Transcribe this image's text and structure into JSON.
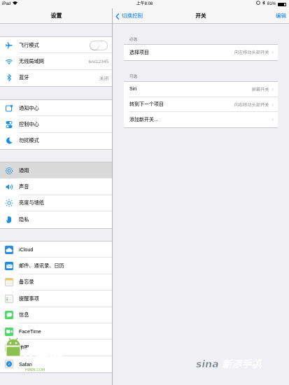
{
  "status_bar": {
    "device": "iPad",
    "time": "上午8:08",
    "battery": "81%",
    "battery_level": 0.81
  },
  "sidebar": {
    "title": "设置",
    "groups": [
      [
        {
          "label": "飞行模式",
          "icon": "airplane-icon",
          "toggle": "off"
        },
        {
          "label": "无线局域网",
          "icon": "wifi-icon",
          "value": "test12345"
        },
        {
          "label": "蓝牙",
          "icon": "bluetooth-icon",
          "value": "关闭"
        }
      ],
      [
        {
          "label": "通知中心",
          "icon": "notification-center-icon"
        },
        {
          "label": "控制中心",
          "icon": "control-center-icon"
        },
        {
          "label": "勿扰模式",
          "icon": "moon-icon"
        }
      ],
      [
        {
          "label": "通用",
          "icon": "gear-icon",
          "selected": true
        },
        {
          "label": "声音",
          "icon": "speaker-icon"
        },
        {
          "label": "亮度与墙纸",
          "icon": "brightness-icon"
        },
        {
          "label": "隐私",
          "icon": "hand-icon"
        }
      ],
      [
        {
          "label": "iCloud",
          "icon": "cloud-icon"
        },
        {
          "label": "邮件、通讯录、日历",
          "icon": "mail-icon"
        },
        {
          "label": "备忘录",
          "icon": "notes-icon"
        },
        {
          "label": "提醒事项",
          "icon": "reminders-icon"
        },
        {
          "label": "信息",
          "icon": "messages-icon"
        },
        {
          "label": "FaceTime",
          "icon": "facetime-icon"
        },
        {
          "label": "地图",
          "icon": "maps-icon"
        },
        {
          "label": "Safari",
          "icon": "safari-icon"
        }
      ]
    ]
  },
  "navbar": {
    "back_label": "切换控制",
    "title": "开关",
    "edit_label": "编辑"
  },
  "main": {
    "sections": [
      {
        "header": "必选",
        "rows": [
          {
            "label": "选择项目",
            "value": "向左移动头部开关"
          }
        ]
      },
      {
        "header": "可选",
        "rows": [
          {
            "label": "Siri",
            "value": "屏幕开关"
          },
          {
            "label": "转到下一个项目",
            "value": "向右移动头部开关"
          },
          {
            "label": "添加新开关...",
            "value": ""
          }
        ]
      }
    ],
    "chevron": "›"
  },
  "watermarks": {
    "left_text": "安卓网",
    "left_sub": "HIAPK.COM",
    "right_text": "sina 新浪手机"
  },
  "colors": {
    "accent": "#007aff",
    "background": "#efeff4",
    "selected_row": "#d9d9d9"
  }
}
